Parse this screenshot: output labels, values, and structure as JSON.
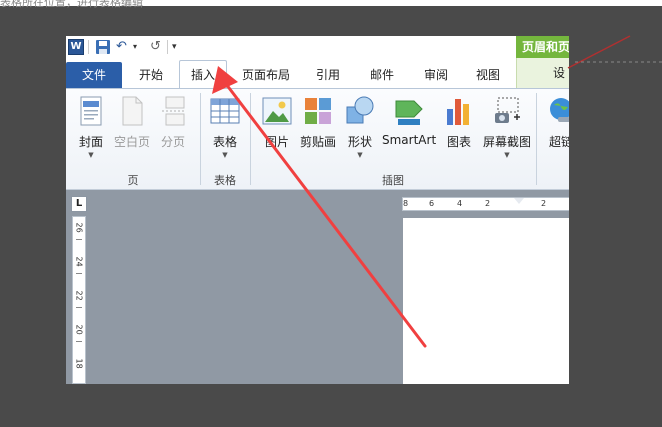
{
  "header_fragment": "表格所在位置，进行表格编辑",
  "qat": {
    "word_icon_glyph": "W",
    "undo_glyph": "↶",
    "redo_glyph": "↺",
    "dropdown_glyph": "▾",
    "customize_glyph": "▾"
  },
  "contextual": {
    "header": "页眉和页",
    "tab": "设计",
    "color": "#74b63d"
  },
  "tabs": [
    "文件",
    "开始",
    "插入",
    "页面布局",
    "引用",
    "邮件",
    "审阅",
    "视图"
  ],
  "active_tab": "插入",
  "ribbon": {
    "pages_group": {
      "label": "页",
      "buttons": [
        "封面",
        "空白页",
        "分页"
      ]
    },
    "table_group": {
      "label": "表格",
      "buttons": [
        "表格"
      ]
    },
    "illustrations_group": {
      "label": "插图",
      "buttons": [
        "图片",
        "剪贴画",
        "形状",
        "SmartArt",
        "图表",
        "屏幕截图"
      ]
    },
    "links_group": {
      "buttons": [
        "超链"
      ]
    }
  },
  "rulers": {
    "horizontal": [
      "8",
      "6",
      "4",
      "2",
      "2"
    ],
    "vertical": [
      "26",
      "24",
      "22",
      "20",
      "18"
    ],
    "corner_glyph": "L"
  },
  "colors": {
    "file_tab": "#2b5ea8",
    "annotation_arrow": "#f04040"
  }
}
